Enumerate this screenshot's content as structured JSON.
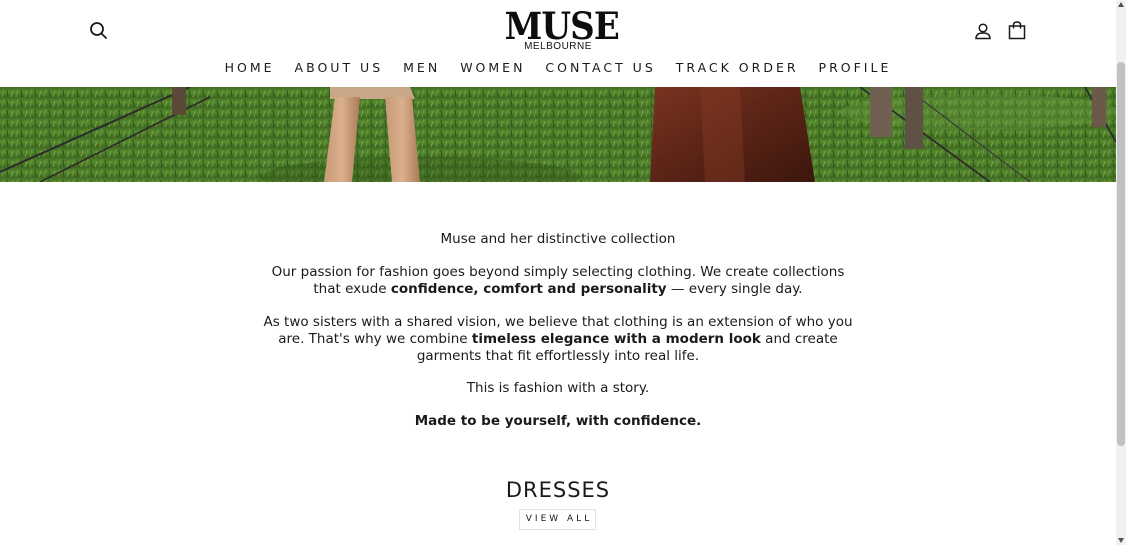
{
  "brand": {
    "logo_main": "MUSE",
    "logo_sub": "MELBOURNE"
  },
  "header": {
    "icons": [
      "search-icon",
      "account-icon",
      "cart-icon"
    ]
  },
  "nav": {
    "items": [
      {
        "label": "HOME"
      },
      {
        "label": "ABOUT US"
      },
      {
        "label": "MEN"
      },
      {
        "label": "WOMEN"
      },
      {
        "label": "CONTACT US"
      },
      {
        "label": "TRACK ORDER"
      },
      {
        "label": "PROFILE"
      }
    ]
  },
  "about": {
    "headline": "Muse and her distinctive collection",
    "p2_before": "Our passion for fashion goes beyond simply selecting clothing. We create collections that exude ",
    "p2_bold": "confidence, comfort and personality",
    "p2_after": " — every single day.",
    "p3_before": "As two sisters with a shared vision, we believe that clothing is an extension of who you are. That's why we combine ",
    "p3_bold": "timeless elegance with a modern look",
    "p3_after": " and create garments that fit effortlessly into real life.",
    "p4": "This is fashion with a story.",
    "p5": "Made to be yourself, with confidence."
  },
  "collection": {
    "title": "DRESSES",
    "view_all_label": "VIEW ALL"
  },
  "colors": {
    "text": "#1a1a1a",
    "background": "#ffffff",
    "grass": "#4f7a2c",
    "border": "#e2e2e2"
  }
}
